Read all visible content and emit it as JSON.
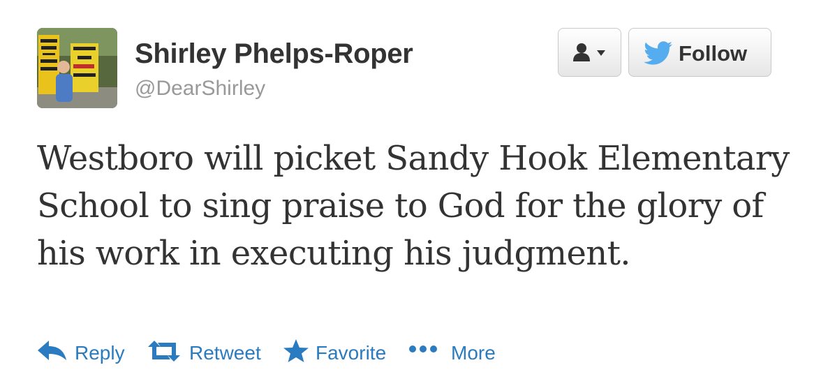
{
  "user": {
    "name": "Shirley Phelps-Roper",
    "handle": "@DearShirley",
    "avatar_sign_text": [
      "THANK GOD FOR DEAD SOLDIERS",
      "SOLDIERS DIE 4 FAG MARRIAGE"
    ]
  },
  "header_buttons": {
    "user_menu_icon": "user-dropdown-icon",
    "follow_icon": "twitter-bird-icon",
    "follow_label": "Follow"
  },
  "tweet": {
    "text": "Westboro will picket Sandy Hook Elementary School to sing praise to God for the glory of his work in executing his judgment."
  },
  "actions": [
    {
      "icon": "reply-arrow-icon",
      "label": "Reply"
    },
    {
      "icon": "retweet-icon",
      "label": "Retweet"
    },
    {
      "icon": "star-icon",
      "label": "Favorite"
    },
    {
      "icon": "more-dots-icon",
      "label": "More"
    }
  ],
  "colors": {
    "text": "#333333",
    "muted": "#999999",
    "link": "#2a7bbf",
    "twitter_blue": "#55acee"
  }
}
